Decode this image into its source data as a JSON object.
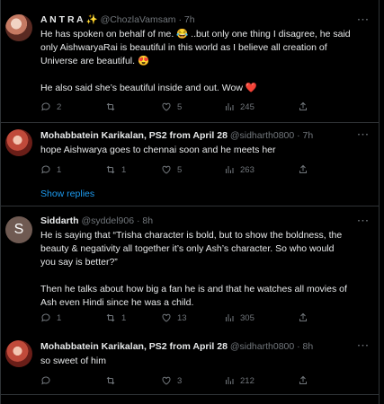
{
  "tweets": [
    {
      "name": "A N T R A",
      "name_emoji": "✨",
      "handle": "@ChozlaVamsam · 7h",
      "lines": [
        "He has spoken on behalf of me. 😂 ..but only one thing I disagree, he said",
        "only AishwaryaRai is beautiful in this world as I believe all creation of",
        "Universe are beautiful. 😍",
        "",
        "He also said she’s beautiful inside and out. Wow ❤️"
      ],
      "actions": {
        "reply": "2",
        "retweet": "",
        "like": "5",
        "views": "245"
      }
    },
    {
      "name": "Mohabbatein Karikalan, PS2 from April 28",
      "handle": "@sidharth0800 · 7h",
      "lines": [
        "hope Aishwarya goes to chennai soon and he meets her"
      ],
      "actions": {
        "reply": "1",
        "retweet": "1",
        "like": "5",
        "views": "263"
      }
    },
    {
      "name": "Siddarth",
      "avatar_letter": "S",
      "handle": "@syddel906 · 8h",
      "lines": [
        "He is saying that “Trisha character is bold, but to show the boldness, the",
        "beauty & negativity all together it’s only Ash’s character. So who would",
        "you say is better?”",
        "",
        "Then he talks about how big a fan he is and that he watches all movies of",
        "Ash even Hindi since he was a child."
      ],
      "actions": {
        "reply": "1",
        "retweet": "1",
        "like": "13",
        "views": "305"
      }
    },
    {
      "name": "Mohabbatein Karikalan, PS2 from April 28",
      "handle": "@sidharth0800 · 8h",
      "lines": [
        "so sweet of him"
      ],
      "actions": {
        "reply": "",
        "retweet": "",
        "like": "3",
        "views": "212"
      }
    }
  ],
  "show_replies": "Show replies",
  "more": "···"
}
